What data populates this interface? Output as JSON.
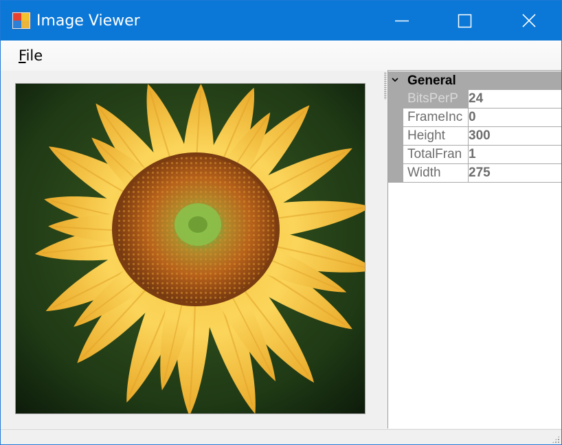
{
  "window": {
    "title": "Image Viewer",
    "title_bar_color": "#0b78d7",
    "controls": [
      "minimize-icon",
      "maximize-icon",
      "close-icon"
    ]
  },
  "menu": {
    "file": {
      "mnemonic": "F",
      "rest": "ile"
    }
  },
  "image": {
    "subject": "sunflower",
    "alt": "Sunflower"
  },
  "property_grid": {
    "category": "General",
    "properties": [
      {
        "name": "BitsPerP",
        "value": "24",
        "selected": true
      },
      {
        "name": "FrameInc",
        "value": "0"
      },
      {
        "name": "Height",
        "value": "300"
      },
      {
        "name": "TotalFran",
        "value": "1"
      },
      {
        "name": "Width",
        "value": "275"
      }
    ]
  }
}
